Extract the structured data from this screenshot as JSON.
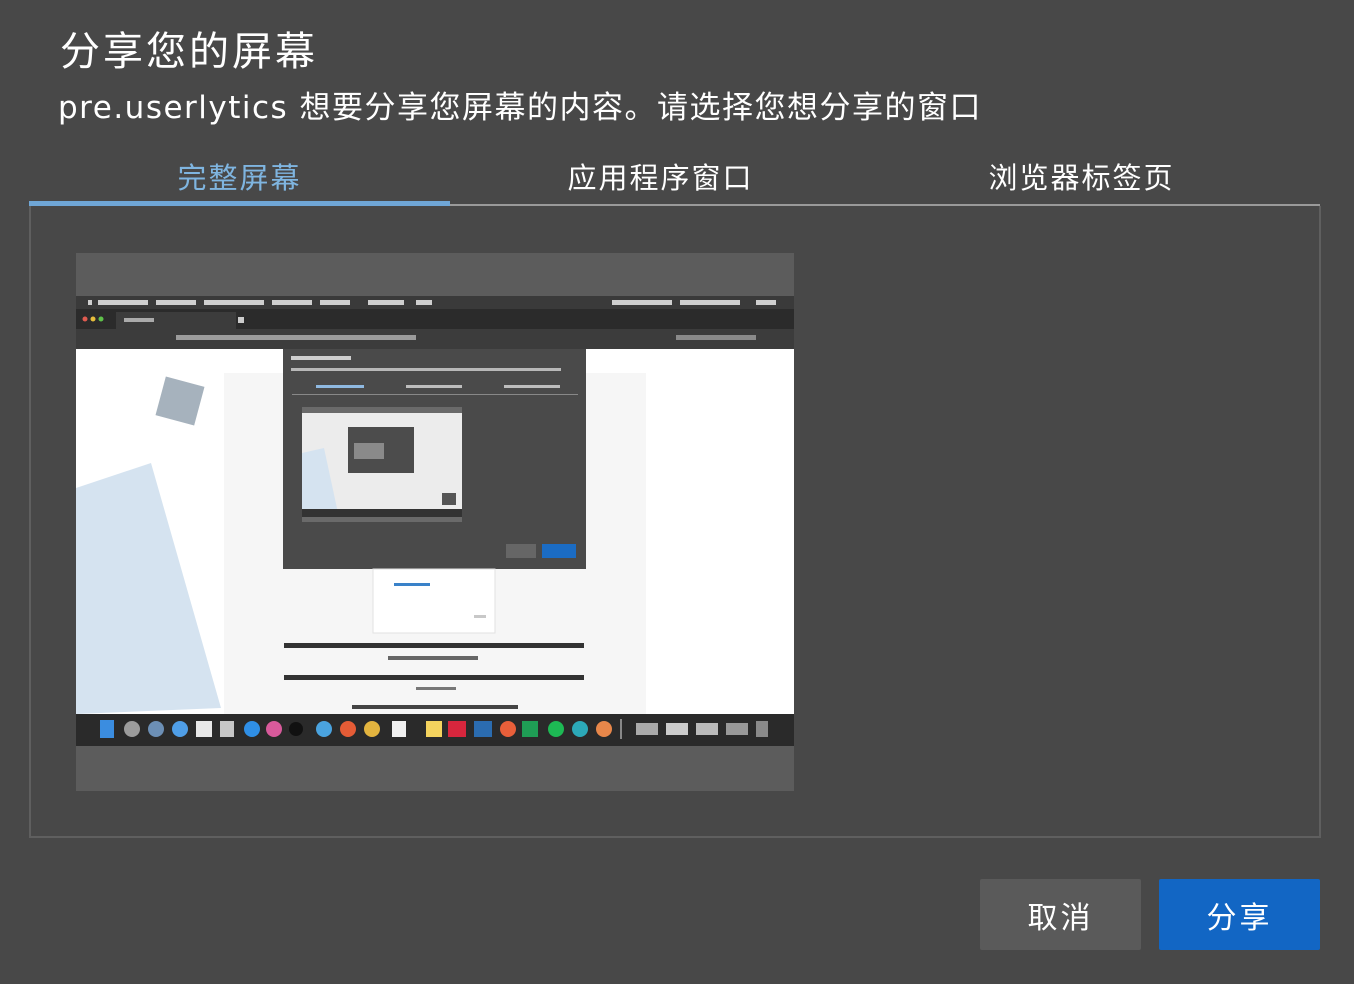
{
  "dialog": {
    "title": "分享您的屏幕",
    "subtitle": "pre.userlytics 想要分享您屏幕的内容。请选择您想分享的窗口"
  },
  "tabs": [
    {
      "label": "完整屏幕",
      "active": true
    },
    {
      "label": "应用程序窗口",
      "active": false
    },
    {
      "label": "浏览器标签页",
      "active": false
    }
  ],
  "buttons": {
    "cancel_label": "取消",
    "share_label": "分享"
  },
  "colors": {
    "background": "#484848",
    "accent": "#6fa6d6",
    "share_button": "#1266c4",
    "cancel_button": "#5a5a5a"
  }
}
